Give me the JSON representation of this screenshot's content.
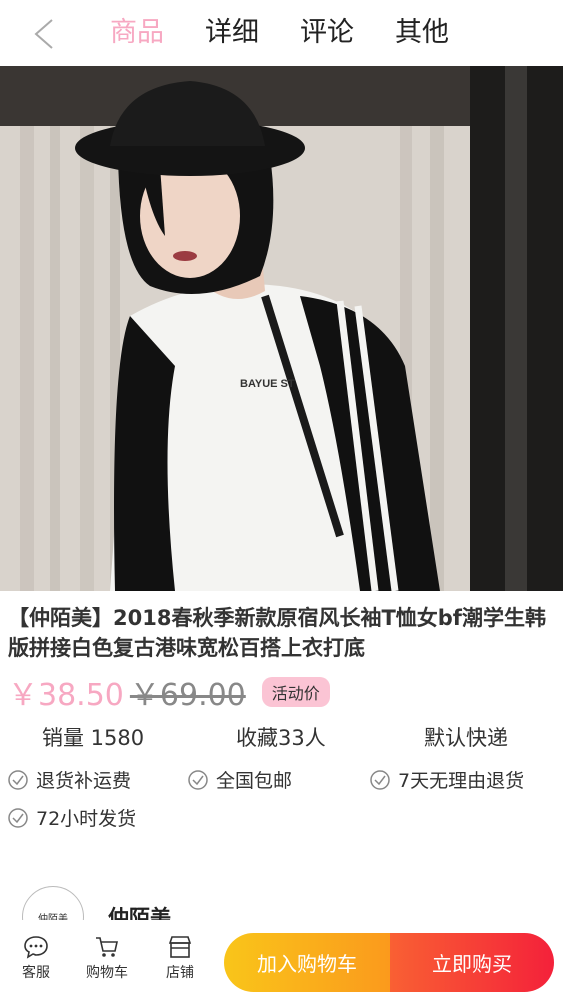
{
  "header": {
    "tabs": [
      {
        "label": "商品",
        "active": true
      },
      {
        "label": "详细",
        "active": false
      },
      {
        "label": "评论",
        "active": false
      },
      {
        "label": "其他",
        "active": false
      }
    ]
  },
  "hero": {
    "image_desc": "model-photo",
    "print_text": "BAYUE ST"
  },
  "product": {
    "title": "【仲陌美】2018春秋季新款原宿风长袖T恤女bf潮学生韩版拼接白色复古港味宽松百搭上衣打底",
    "price": "￥38.50",
    "old_price": "￥69.00",
    "badge": "活动价",
    "accent_color": "#f7a8c2"
  },
  "stats": {
    "sales": "销量 1580",
    "favorites": "收藏33人",
    "shipping": "默认快递"
  },
  "services": [
    "退货补运费",
    "全国包邮",
    "7天无理由退货",
    "72小时发货"
  ],
  "shop": {
    "logo_text": "仲陌美",
    "name": "仲陌美"
  },
  "bottom": {
    "service_label": "客服",
    "cart_label": "购物车",
    "store_label": "店铺",
    "add_cart": "加入购物车",
    "buy_now": "立即购买"
  }
}
